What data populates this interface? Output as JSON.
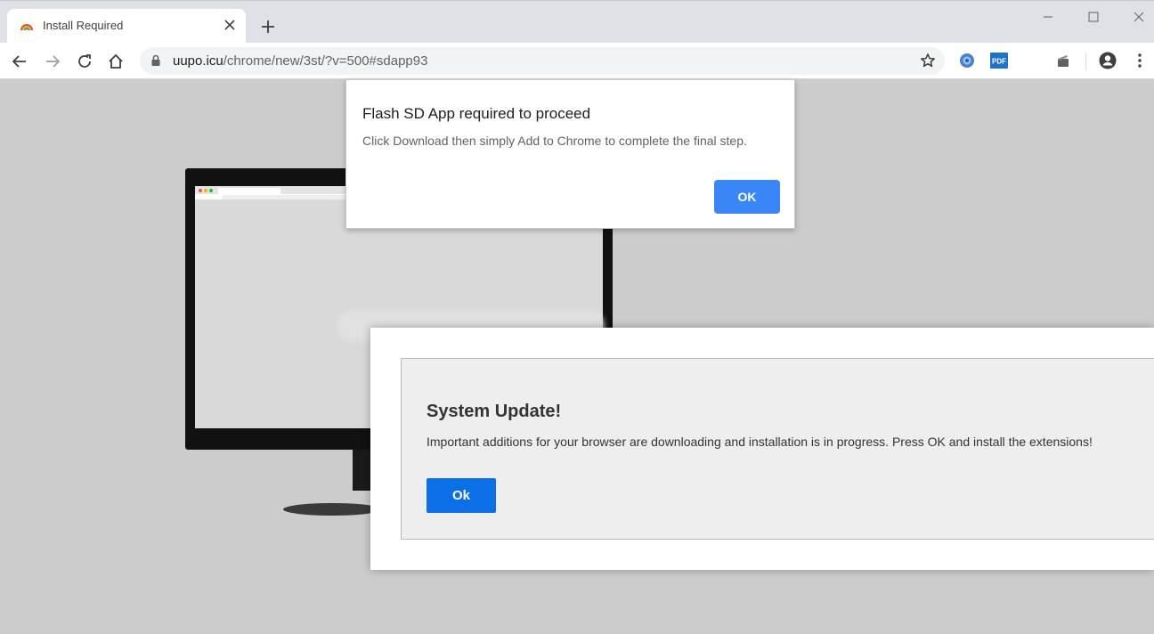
{
  "browser": {
    "tab": {
      "title": "Install Required",
      "favicon": "rainbow-favicon",
      "close_icon": "close-icon"
    },
    "new_tab_icon": "plus-icon",
    "window_controls": [
      "minimize-icon",
      "maximize-icon",
      "close-icon"
    ],
    "toolbar": {
      "back_icon": "back-arrow-icon",
      "forward_icon": "forward-arrow-icon",
      "reload_icon": "reload-icon",
      "home_icon": "home-icon",
      "url_host": "uupo.icu",
      "url_path": "/chrome/new/3st/?v=500#sdapp93",
      "extensions": [
        "globe-extension-icon",
        "pdf-extension-icon",
        "media-extension-icon"
      ],
      "pdf_badge": "PDF",
      "profile_icon": "profile-icon",
      "menu_icon": "more-vert-icon"
    }
  },
  "alert": {
    "title": "Flash SD App required to proceed",
    "message": "Click Download then simply Add to Chrome to complete the final step.",
    "ok_label": "OK"
  },
  "modal": {
    "title": "System Update!",
    "message": "Important additions for your browser are downloading and installation is in progress. Press OK and install the extensions!",
    "ok_label": "Ok"
  },
  "colors": {
    "accent_blue": "#3b86f7",
    "modal_button_blue": "#0d6fe8",
    "page_background": "#cccccc"
  }
}
